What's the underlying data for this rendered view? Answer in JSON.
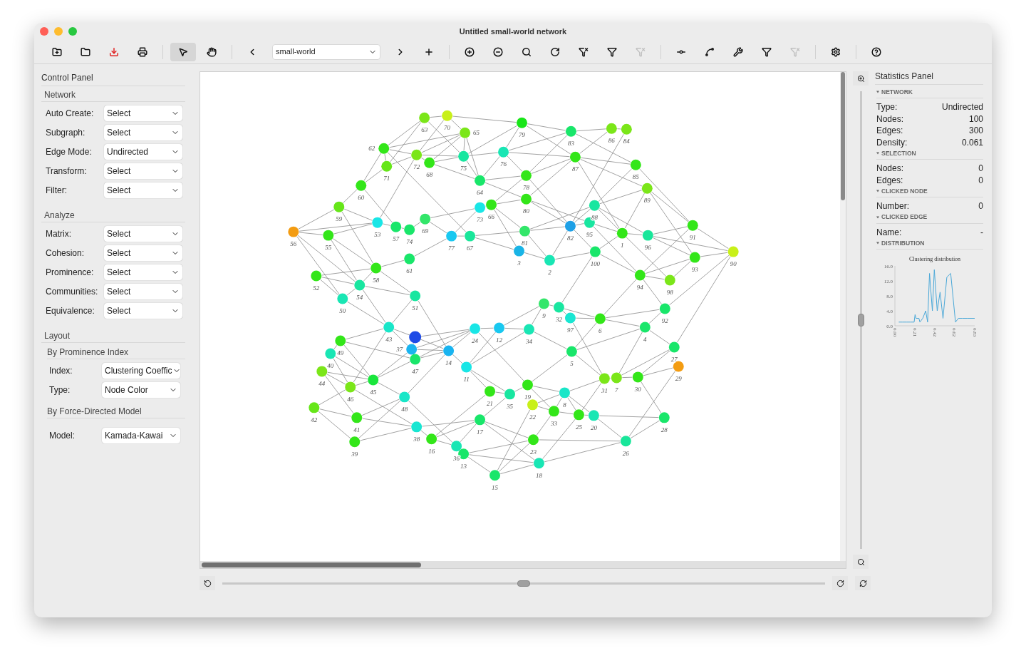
{
  "window": {
    "title": "Untitled small-world network"
  },
  "toolbar": {
    "tools": [
      {
        "kind": "new-folder",
        "disabled": false
      },
      {
        "kind": "folder",
        "disabled": false
      },
      {
        "kind": "download",
        "disabled": false
      },
      {
        "kind": "print",
        "disabled": false
      },
      {
        "kind": "sep"
      },
      {
        "kind": "select-mode",
        "selected": true
      },
      {
        "kind": "hand-mode",
        "selected": false
      },
      {
        "kind": "sep"
      },
      {
        "kind": "prev",
        "disabled": false
      },
      {
        "kind": "network-select",
        "value": "small-world"
      },
      {
        "kind": "next",
        "disabled": false
      },
      {
        "kind": "add",
        "disabled": false
      },
      {
        "kind": "sep"
      },
      {
        "kind": "zoom-in",
        "disabled": false
      },
      {
        "kind": "zoom-out",
        "disabled": false
      },
      {
        "kind": "search",
        "disabled": false
      },
      {
        "kind": "reload",
        "disabled": false
      },
      {
        "kind": "filter-x",
        "disabled": false
      },
      {
        "kind": "filter-edit",
        "disabled": false
      },
      {
        "kind": "filter-x",
        "disabled": true
      },
      {
        "kind": "sep"
      },
      {
        "kind": "edge",
        "disabled": false
      },
      {
        "kind": "edge-dots",
        "disabled": false
      },
      {
        "kind": "tools",
        "disabled": false
      },
      {
        "kind": "filter-edit",
        "disabled": false
      },
      {
        "kind": "filter-x",
        "disabled": true
      },
      {
        "kind": "sep"
      },
      {
        "kind": "settings",
        "disabled": false
      },
      {
        "kind": "sep"
      },
      {
        "kind": "help",
        "disabled": false
      }
    ]
  },
  "control_panel": {
    "title": "Control Panel",
    "sections": [
      {
        "title": "Network",
        "rows": [
          {
            "label": "Auto Create:",
            "value": "Select"
          },
          {
            "label": "Subgraph:",
            "value": "Select"
          },
          {
            "label": "Edge Mode:",
            "value": "Undirected"
          },
          {
            "label": "Transform:",
            "value": "Select"
          },
          {
            "label": "Filter:",
            "value": "Select"
          }
        ]
      },
      {
        "title": "Analyze",
        "rows": [
          {
            "label": "Matrix:",
            "value": "Select"
          },
          {
            "label": "Cohesion:",
            "value": "Select"
          },
          {
            "label": "Prominence:",
            "value": "Select"
          },
          {
            "label": "Communities:",
            "value": "Select"
          },
          {
            "label": "Equivalence:",
            "value": "Select"
          }
        ]
      },
      {
        "title": "Layout",
        "subsections": [
          {
            "title": "By Prominence Index",
            "rows": [
              {
                "label": "Index:",
                "value": "Clustering Coeffic"
              },
              {
                "label": "Type:",
                "value": "Node Color"
              }
            ]
          },
          {
            "title": "By Force-Directed Model",
            "rows": [
              {
                "label": "Model:",
                "value": "Kamada-Kawai"
              }
            ]
          }
        ]
      }
    ]
  },
  "graph": {
    "nodes": [
      {
        "label": "63",
        "color": "#7be619"
      },
      {
        "label": "70",
        "color": "#c8f019"
      },
      {
        "label": "65",
        "color": "#7be619"
      },
      {
        "label": "62",
        "color": "#33e619"
      },
      {
        "label": "72",
        "color": "#7be619"
      },
      {
        "label": "71",
        "color": "#66e619"
      },
      {
        "label": "68",
        "color": "#33e619"
      },
      {
        "label": "75",
        "color": "#19e6a0"
      },
      {
        "label": "76",
        "color": "#19e6b4"
      },
      {
        "label": "79",
        "color": "#19e619"
      },
      {
        "label": "64",
        "color": "#19e66a"
      },
      {
        "label": "60",
        "color": "#33e619"
      },
      {
        "label": "59",
        "color": "#66e619"
      },
      {
        "label": "73",
        "color": "#19e6e6"
      },
      {
        "label": "66",
        "color": "#33e619"
      },
      {
        "label": "80",
        "color": "#33e619"
      },
      {
        "label": "56",
        "color": "#f39c12"
      },
      {
        "label": "55",
        "color": "#33e619"
      },
      {
        "label": "53",
        "color": "#19e6e6"
      },
      {
        "label": "57",
        "color": "#19e66a"
      },
      {
        "label": "74",
        "color": "#19e66a"
      },
      {
        "label": "69",
        "color": "#33e66a"
      },
      {
        "label": "77",
        "color": "#19c8f0"
      },
      {
        "label": "67",
        "color": "#19e69a"
      },
      {
        "label": "58",
        "color": "#33e619"
      },
      {
        "label": "61",
        "color": "#19e66a"
      },
      {
        "label": "52",
        "color": "#33e619"
      },
      {
        "label": "54",
        "color": "#19e6a0"
      },
      {
        "label": "50",
        "color": "#19e6b4"
      },
      {
        "label": "51",
        "color": "#19e6a0"
      },
      {
        "label": "43",
        "color": "#19e6c8"
      },
      {
        "color": "#1e4be6"
      },
      {
        "label": "37",
        "color": "#19b4f0"
      },
      {
        "label": "47",
        "color": "#19e66a"
      },
      {
        "label": "49",
        "color": "#33e619"
      },
      {
        "label": "40",
        "color": "#19e6b4"
      },
      {
        "label": "44",
        "color": "#7be619"
      },
      {
        "label": "46",
        "color": "#7be619"
      },
      {
        "label": "45",
        "color": "#19e63c"
      },
      {
        "label": "48",
        "color": "#19e6c8"
      },
      {
        "label": "42",
        "color": "#66e619"
      },
      {
        "label": "41",
        "color": "#33e619"
      },
      {
        "label": "39",
        "color": "#33e619"
      },
      {
        "label": "38",
        "color": "#19e6d2"
      },
      {
        "label": "16",
        "color": "#33e619"
      },
      {
        "label": "36",
        "color": "#19e6b4"
      },
      {
        "label": "13",
        "color": "#19e66a"
      },
      {
        "label": "15",
        "color": "#19e66a"
      },
      {
        "label": "17",
        "color": "#19e66a"
      },
      {
        "label": "21",
        "color": "#33e619"
      },
      {
        "label": "35",
        "color": "#19e6a0"
      },
      {
        "label": "24",
        "color": "#19e6e6"
      },
      {
        "label": "12",
        "color": "#19c8f0"
      },
      {
        "label": "14",
        "color": "#19b4f0"
      },
      {
        "label": "11",
        "color": "#19e6e6"
      },
      {
        "label": "83",
        "color": "#19e66a"
      },
      {
        "label": "86",
        "color": "#7be619"
      },
      {
        "label": "84",
        "color": "#7be619"
      },
      {
        "label": "87",
        "color": "#33e619"
      },
      {
        "label": "85",
        "color": "#33e619"
      },
      {
        "label": "89",
        "color": "#7be619"
      },
      {
        "label": "88",
        "color": "#19e6a0"
      },
      {
        "label": "95",
        "color": "#19e6a0"
      },
      {
        "label": "82",
        "color": "#1ea0e6"
      },
      {
        "label": "81",
        "color": "#33e66a"
      },
      {
        "label": "3",
        "color": "#19b4e6"
      },
      {
        "label": "2",
        "color": "#19e6b4"
      },
      {
        "label": "100",
        "color": "#19e66a"
      },
      {
        "label": "1",
        "color": "#33e619"
      },
      {
        "label": "96",
        "color": "#19e69a"
      },
      {
        "label": "91",
        "color": "#33e619"
      },
      {
        "label": "93",
        "color": "#33e619"
      },
      {
        "label": "90",
        "color": "#c8f019"
      },
      {
        "label": "94",
        "color": "#33e619"
      },
      {
        "label": "98",
        "color": "#7be619"
      },
      {
        "label": "92",
        "color": "#19e66a"
      },
      {
        "label": "9",
        "color": "#33e66a"
      },
      {
        "label": "32",
        "color": "#19e6a0"
      },
      {
        "label": "97",
        "color": "#19e6d2"
      },
      {
        "label": "6",
        "color": "#33e619"
      },
      {
        "label": "4",
        "color": "#19e66a"
      },
      {
        "label": "34",
        "color": "#19e6b4"
      },
      {
        "label": "5",
        "color": "#19e66a"
      },
      {
        "label": "27",
        "color": "#19e66a"
      },
      {
        "label": "29",
        "color": "#f39c12"
      },
      {
        "label": "31",
        "color": "#7be619"
      },
      {
        "label": "7",
        "color": "#7be619"
      },
      {
        "label": "30",
        "color": "#33e619"
      },
      {
        "label": "19",
        "color": "#33e619"
      },
      {
        "label": "8",
        "color": "#19e6c8"
      },
      {
        "label": "22",
        "color": "#c8f019"
      },
      {
        "label": "33",
        "color": "#33e619"
      },
      {
        "label": "25",
        "color": "#33e619"
      },
      {
        "label": "20",
        "color": "#19e6b4"
      },
      {
        "label": "28",
        "color": "#19e66a"
      },
      {
        "label": "23",
        "color": "#33e619"
      },
      {
        "label": "26",
        "color": "#19e69a"
      },
      {
        "label": "18",
        "color": "#19e6b4"
      },
      {
        "label": "78",
        "color": "#33e619"
      }
    ]
  },
  "rotation": {
    "level": 0.5
  },
  "zoom": {
    "level": 0.5
  },
  "statistics_panel": {
    "title": "Statistics Panel",
    "sections": [
      {
        "title": "NETWORK",
        "rows": [
          {
            "label": "Type:",
            "value": "Undirected"
          },
          {
            "label": "Nodes:",
            "value": "100"
          },
          {
            "label": "Edges:",
            "value": "300"
          },
          {
            "label": "Density:",
            "value": "0.061"
          }
        ]
      },
      {
        "title": "SELECTION",
        "rows": [
          {
            "label": "Nodes:",
            "value": "0"
          },
          {
            "label": "Edges:",
            "value": "0"
          }
        ]
      },
      {
        "title": "CLICKED NODE",
        "rows": [
          {
            "label": "Number:",
            "value": "0"
          }
        ]
      },
      {
        "title": "CLICKED EDGE",
        "rows": [
          {
            "label": "Name:",
            "value": "-"
          }
        ]
      },
      {
        "title": "DISTRIBUTION",
        "chart_data": {
          "type": "line",
          "title": "Clustering distribution",
          "x": [
            0.04,
            0.08,
            0.12,
            0.16,
            0.2,
            0.21,
            0.22,
            0.25,
            0.26,
            0.29,
            0.32,
            0.34,
            0.36,
            0.39,
            0.41,
            0.44,
            0.47,
            0.5,
            0.54,
            0.58,
            0.63,
            0.66,
            0.7,
            0.75,
            0.8,
            0.83
          ],
          "series": [
            {
              "color": "#4aa8d8",
              "values": [
                1,
                1,
                1,
                1,
                1,
                3,
                2,
                2,
                1,
                2,
                4,
                1,
                14,
                4,
                15,
                4,
                9,
                2,
                13,
                14,
                1,
                2,
                2,
                2,
                2,
                2
              ]
            }
          ],
          "xlim": [
            0,
            0.83
          ],
          "ylim": [
            0,
            16
          ],
          "xticks": [
            {
              "value": 0,
              "label": "0.00"
            },
            {
              "value": 0.21,
              "label": "0.21"
            },
            {
              "value": 0.42,
              "label": "0.42"
            },
            {
              "value": 0.62,
              "label": "0.62"
            },
            {
              "value": 0.83,
              "label": "0.83"
            }
          ],
          "yticks": [
            {
              "value": 0,
              "label": "0.0"
            },
            {
              "value": 4,
              "label": "4.0"
            },
            {
              "value": 8,
              "label": "8.0"
            },
            {
              "value": 12,
              "label": "12.0"
            },
            {
              "value": 16,
              "label": "16.0"
            }
          ]
        }
      }
    ]
  }
}
